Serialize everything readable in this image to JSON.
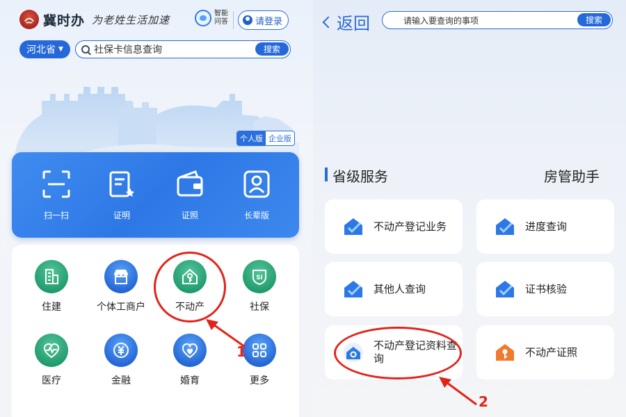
{
  "left_panel": {
    "brand": "冀时办",
    "slogan": "为老姓生活加速",
    "ai_assistant": {
      "label_line1": "智能",
      "label_line2": "问答"
    },
    "login_label": "请登录",
    "province": "河北省",
    "search": {
      "query": "社保卡信息查询",
      "button": "搜索"
    },
    "version_toggle": {
      "personal": "个人版",
      "business": "企业版"
    },
    "quick_actions": [
      {
        "label": "扫一扫",
        "icon": "scan-icon"
      },
      {
        "label": "证明",
        "icon": "certificate-icon"
      },
      {
        "label": "证照",
        "icon": "wallet-icon"
      },
      {
        "label": "长辈版",
        "icon": "elder-icon"
      }
    ],
    "services": [
      {
        "label": "住建",
        "icon": "building-icon",
        "color": "#1f9a6b"
      },
      {
        "label": "个体工商户",
        "icon": "shop-icon",
        "color": "#2264d4"
      },
      {
        "label": "不动产",
        "icon": "house-key-icon",
        "color": "#1f9a6b"
      },
      {
        "label": "社保",
        "icon": "social-security-icon",
        "color": "#1f9a6b"
      },
      {
        "label": "医疗",
        "icon": "heart-pulse-icon",
        "color": "#1f9a6b"
      },
      {
        "label": "金融",
        "icon": "yuan-icon",
        "color": "#2264d4"
      },
      {
        "label": "婚育",
        "icon": "heart-icon",
        "color": "#2264d4"
      },
      {
        "label": "更多",
        "icon": "grid-icon",
        "color": "#2264d4"
      }
    ],
    "annotation_number": "1"
  },
  "right_panel": {
    "back_label": "返回",
    "search": {
      "placeholder": "请输入要查询的事项",
      "button": "搜索"
    },
    "section_title": "省级服务",
    "section_right": "房管助手",
    "tiles": [
      {
        "label": "不动产登记业务",
        "icon": "check-house-icon"
      },
      {
        "label": "进度查询",
        "icon": "check-house-icon"
      },
      {
        "label": "其他人查询",
        "icon": "check-house-icon"
      },
      {
        "label": "证书核验",
        "icon": "check-house-icon"
      },
      {
        "label": "不动产登记资料查询",
        "icon": "house-search-icon"
      },
      {
        "label": "不动产证照",
        "icon": "house-key-icon"
      }
    ],
    "annotation_number": "2"
  },
  "colors": {
    "primary_blue": "#2468d9",
    "green": "#1f9a6b",
    "annotation_red": "#e2231a",
    "orange": "#f07a2e"
  }
}
